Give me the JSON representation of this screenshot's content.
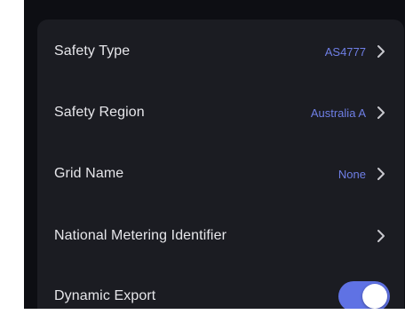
{
  "colors": {
    "screen_background": "#0d0e13",
    "card_background": "#1b1c22",
    "label_text": "#e6e6ea",
    "value_text": "#6f7fe6",
    "chevron": "#c9c9cf",
    "toggle_on": "#5f72e4"
  },
  "settings": {
    "safety_type": {
      "label": "Safety Type",
      "value": "AS4777",
      "icon": "chevron-right-icon"
    },
    "safety_region": {
      "label": "Safety Region",
      "value": "Australia A",
      "icon": "chevron-right-icon"
    },
    "grid_name": {
      "label": "Grid Name",
      "value": "None",
      "icon": "chevron-right-icon"
    },
    "nmi": {
      "label": "National Metering Identifier",
      "value": "",
      "icon": "chevron-right-icon"
    },
    "dynamic_export": {
      "label": "Dynamic Export",
      "enabled": true
    }
  }
}
